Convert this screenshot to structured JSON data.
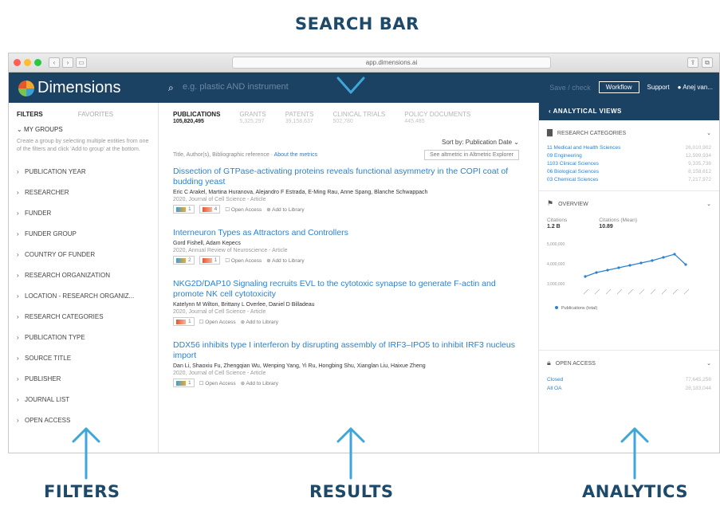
{
  "callouts": {
    "search_bar": "SEARCH BAR",
    "filters": "FILTERS",
    "results": "RESULTS",
    "analytics": "ANALYTICS"
  },
  "browser": {
    "url": "app.dimensions.ai"
  },
  "app": {
    "logo_text": "Dimensions",
    "search_placeholder": "e.g. plastic AND instrument",
    "save_check": "Save / check",
    "workflow_label": "Workflow",
    "support_label": "Support",
    "user_label": "Anej van..."
  },
  "filters": {
    "tab_filters": "FILTERS",
    "tab_favorites": "FAVORITES",
    "my_groups": "MY GROUPS",
    "my_groups_desc": "Create a group by selecting multiple entities from one of the filters and click 'Add to group' at the bottom.",
    "items": [
      "PUBLICATION YEAR",
      "RESEARCHER",
      "FUNDER",
      "FUNDER GROUP",
      "COUNTRY OF FUNDER",
      "RESEARCH ORGANIZATION",
      "LOCATION - RESEARCH ORGANIZ...",
      "RESEARCH CATEGORIES",
      "PUBLICATION TYPE",
      "SOURCE TITLE",
      "PUBLISHER",
      "JOURNAL LIST",
      "OPEN ACCESS"
    ]
  },
  "results": {
    "tabs": [
      {
        "label": "PUBLICATIONS",
        "count": "105,820,495"
      },
      {
        "label": "GRANTS",
        "count": "5,325,297"
      },
      {
        "label": "PATENTS",
        "count": "39,158,637"
      },
      {
        "label": "CLINICAL TRIALS",
        "count": "502,780"
      },
      {
        "label": "POLICY DOCUMENTS",
        "count": "445,485"
      }
    ],
    "sort_label": "Sort by: Publication Date",
    "ref_text": "Title, Author(s), Bibliographic reference",
    "about_metrics": "About the metrics",
    "altmetric_btn": "See altmetric in Altmetric Explorer",
    "open_access": "Open Access",
    "add_to_library": "Add to Library",
    "publications": [
      {
        "title": "Dissection of GTPase-activating proteins reveals functional asymmetry in the COPI coat of budding yeast",
        "authors": "Eric C Arakel, Martina Huranova, Alejandro F Estrada, E-Ming Rau, Anne Spang, Blanche Schwappach",
        "meta": "2020, Journal of Cell Science - Article",
        "dims": "1",
        "alt": "4"
      },
      {
        "title": "Interneuron Types as Attractors and Controllers",
        "authors": "Gord Fishell, Adam Kepecs",
        "meta": "2020, Annual Review of Neuroscience - Article",
        "dims": "2",
        "alt": "1"
      },
      {
        "title": "NKG2D/DAP10 Signaling recruits EVL to the cytotoxic synapse to generate F-actin and promote NK cell cytotoxicity",
        "authors": "Katelynn M Wilton, Brittany L Overlee, Daniel D Billadeau",
        "meta": "2020, Journal of Cell Science - Article",
        "dims": "",
        "alt": "1"
      },
      {
        "title": "DDX56 inhibits type I interferon by disrupting assembly of IRF3–IPO5 to inhibit IRF3 nucleus import",
        "authors": "Dan Li, Shaoxiu Fu, Zhengqian Wu, Wenping Yang, Yi Ru, Hongbing Shu, Xianglan Liu, Haixue Zheng",
        "meta": "2020, Journal of Cell Science - Article",
        "dims": "1",
        "alt": ""
      }
    ]
  },
  "analytics": {
    "header": "ANALYTICAL VIEWS",
    "research_categories": {
      "title": "RESEARCH CATEGORIES",
      "rows": [
        {
          "name": "11 Medical and Health Sciences",
          "value": "26,010,902"
        },
        {
          "name": "09 Engineering",
          "value": "12,599,934"
        },
        {
          "name": "1103 Clinical Sciences",
          "value": "9,335,736"
        },
        {
          "name": "06 Biological Sciences",
          "value": "8,158,612"
        },
        {
          "name": "03 Chemical Sciences",
          "value": "7,217,972"
        }
      ]
    },
    "overview": {
      "title": "OVERVIEW",
      "citations_label": "Citations",
      "citations_value": "1.2 B",
      "mean_label": "Citations (Mean)",
      "mean_value": "10.89",
      "y_ticks": [
        "5,000,000",
        "4,000,000",
        "3,000,000"
      ],
      "legend": "Publications (total)"
    },
    "open_access": {
      "title": "OPEN ACCESS",
      "rows": [
        {
          "name": "Closed",
          "value": "77,645,258"
        },
        {
          "name": "All OA",
          "value": "28,183,044"
        }
      ]
    }
  }
}
